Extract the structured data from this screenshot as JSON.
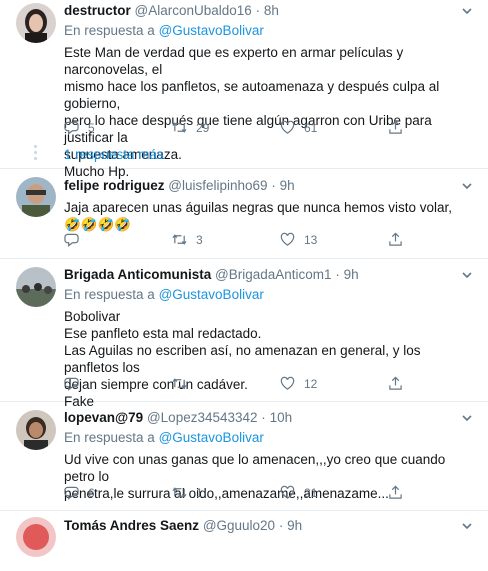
{
  "reply_prefix": "En respuesta a",
  "tweets": [
    {
      "name": "destructor",
      "handle": "@AlarconUbaldo16",
      "time": "8h",
      "reply_to": "@GustavoBolivar",
      "lines": [
        "Este Man de verdad que es experto en armar películas y narconovelas, el",
        "mismo hace los panfletos, se autoamenaza y después culpa al gobierno,",
        "pero lo hace después que tiene algún agarron con Uribe para justificar la",
        "supuesta amenaza.",
        "Mucho Hp."
      ],
      "replies": "5",
      "retweets": "29",
      "likes": "61",
      "more_replies": "1 respuesta más"
    },
    {
      "name": "felipe rodriguez",
      "handle": "@luisfelipinho69",
      "time": "9h",
      "lines": [
        "Jaja aparecen unas águilas negras que nunca hemos visto volar, 🤣🤣🤣🤣"
      ],
      "replies": "",
      "retweets": "3",
      "likes": "13"
    },
    {
      "name": "Brigada Anticomunista",
      "handle": "@BrigadaAnticom1",
      "time": "9h",
      "reply_to": "@GustavoBolivar",
      "lines": [
        "Bobolivar",
        "Ese panfleto esta mal redactado.",
        "Las Aguilas no escriben así, no amenazan en general, y los panfletos los",
        "dejan siempre con un cadáver.",
        "Fake"
      ],
      "replies": "",
      "retweets": "",
      "likes": "12"
    },
    {
      "name": "lopevan@79",
      "handle": "@Lopez34543342",
      "time": "10h",
      "reply_to": "@GustavoBolivar",
      "lines": [
        "Ud vive con unas ganas que lo amenacen,,,yo creo que cuando petro lo",
        "penetra,le surrura al oido,,amenazame,,amenazame..."
      ],
      "replies": "6",
      "retweets": "1",
      "likes": "21"
    },
    {
      "name": "Tomás Andres Saenz",
      "handle": "@Gguulo20",
      "time": "9h"
    }
  ]
}
